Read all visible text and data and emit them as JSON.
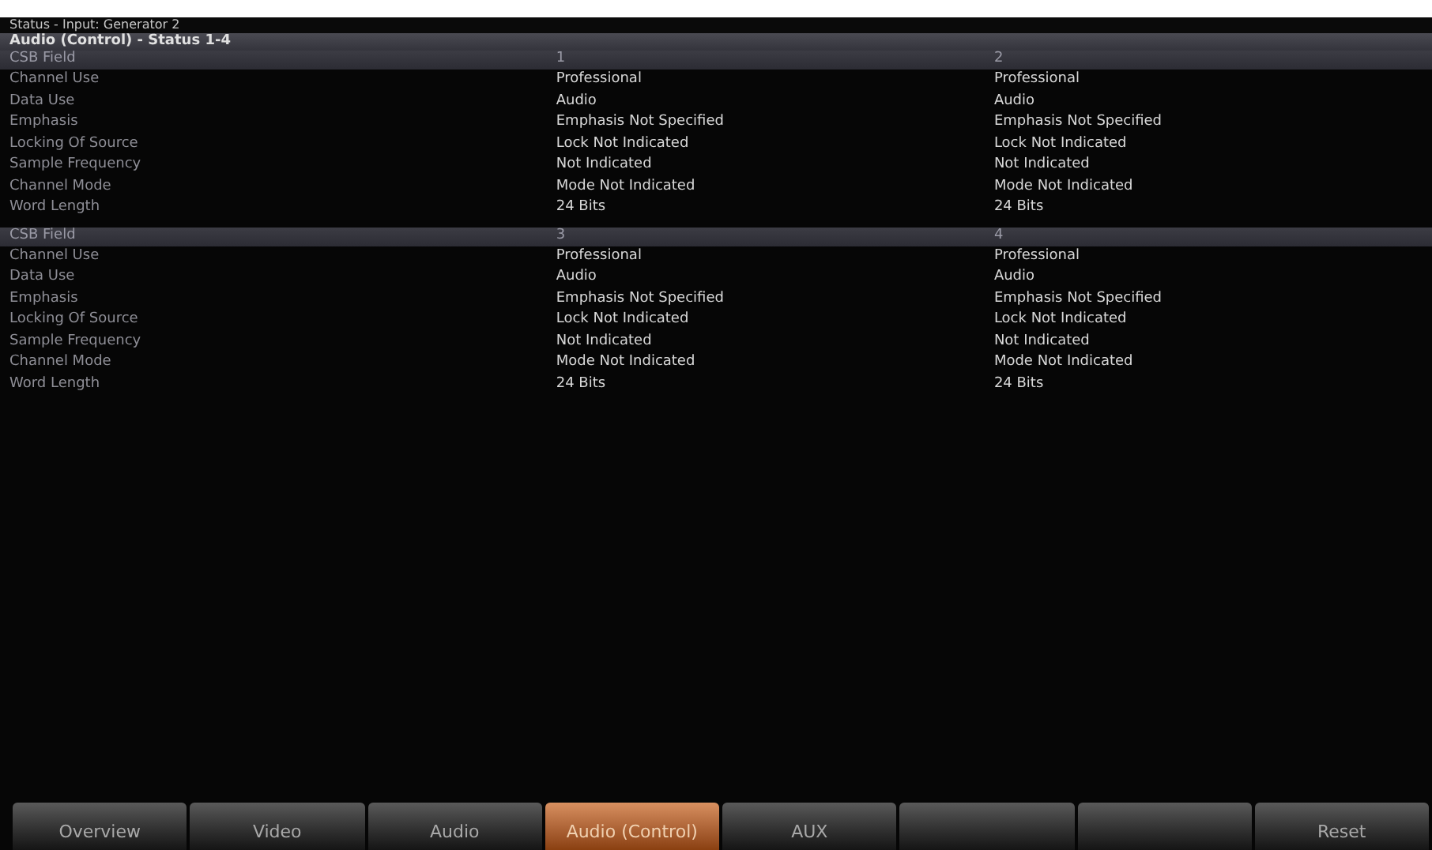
{
  "window": {
    "title": "Status - Input: Generator 2"
  },
  "section_title": "Audio (Control) - Status 1-4",
  "tables": [
    {
      "header": {
        "label": "CSB Field",
        "columns": [
          "1",
          "2"
        ]
      },
      "rows": [
        {
          "label": "Channel Use",
          "values": [
            "Professional",
            "Professional"
          ]
        },
        {
          "label": "Data Use",
          "values": [
            "Audio",
            "Audio"
          ]
        },
        {
          "label": "Emphasis",
          "values": [
            "Emphasis Not Specified",
            "Emphasis Not Specified"
          ]
        },
        {
          "label": "Locking Of Source",
          "values": [
            "Lock Not Indicated",
            "Lock Not Indicated"
          ]
        },
        {
          "label": "Sample Frequency",
          "values": [
            "Not Indicated",
            "Not Indicated"
          ]
        },
        {
          "label": "Channel Mode",
          "values": [
            "Mode Not Indicated",
            "Mode Not Indicated"
          ]
        },
        {
          "label": "Word Length",
          "values": [
            "24 Bits",
            "24 Bits"
          ]
        }
      ]
    },
    {
      "header": {
        "label": "CSB Field",
        "columns": [
          "3",
          "4"
        ]
      },
      "rows": [
        {
          "label": "Channel Use",
          "values": [
            "Professional",
            "Professional"
          ]
        },
        {
          "label": "Data Use",
          "values": [
            "Audio",
            "Audio"
          ]
        },
        {
          "label": "Emphasis",
          "values": [
            "Emphasis Not Specified",
            "Emphasis Not Specified"
          ]
        },
        {
          "label": "Locking Of Source",
          "values": [
            "Lock Not Indicated",
            "Lock Not Indicated"
          ]
        },
        {
          "label": "Sample Frequency",
          "values": [
            "Not Indicated",
            "Not Indicated"
          ]
        },
        {
          "label": "Channel Mode",
          "values": [
            "Mode Not Indicated",
            "Mode Not Indicated"
          ]
        },
        {
          "label": "Word Length",
          "values": [
            "24 Bits",
            "24 Bits"
          ]
        }
      ]
    }
  ],
  "tabs": [
    {
      "label": "Overview",
      "selected": false
    },
    {
      "label": "Video",
      "selected": false
    },
    {
      "label": "Audio",
      "selected": false
    },
    {
      "label": "Audio (Control)",
      "selected": true
    },
    {
      "label": "AUX",
      "selected": false
    },
    {
      "selected": false
    },
    {
      "selected": false
    },
    {
      "label": "Reset",
      "selected": false
    }
  ]
}
